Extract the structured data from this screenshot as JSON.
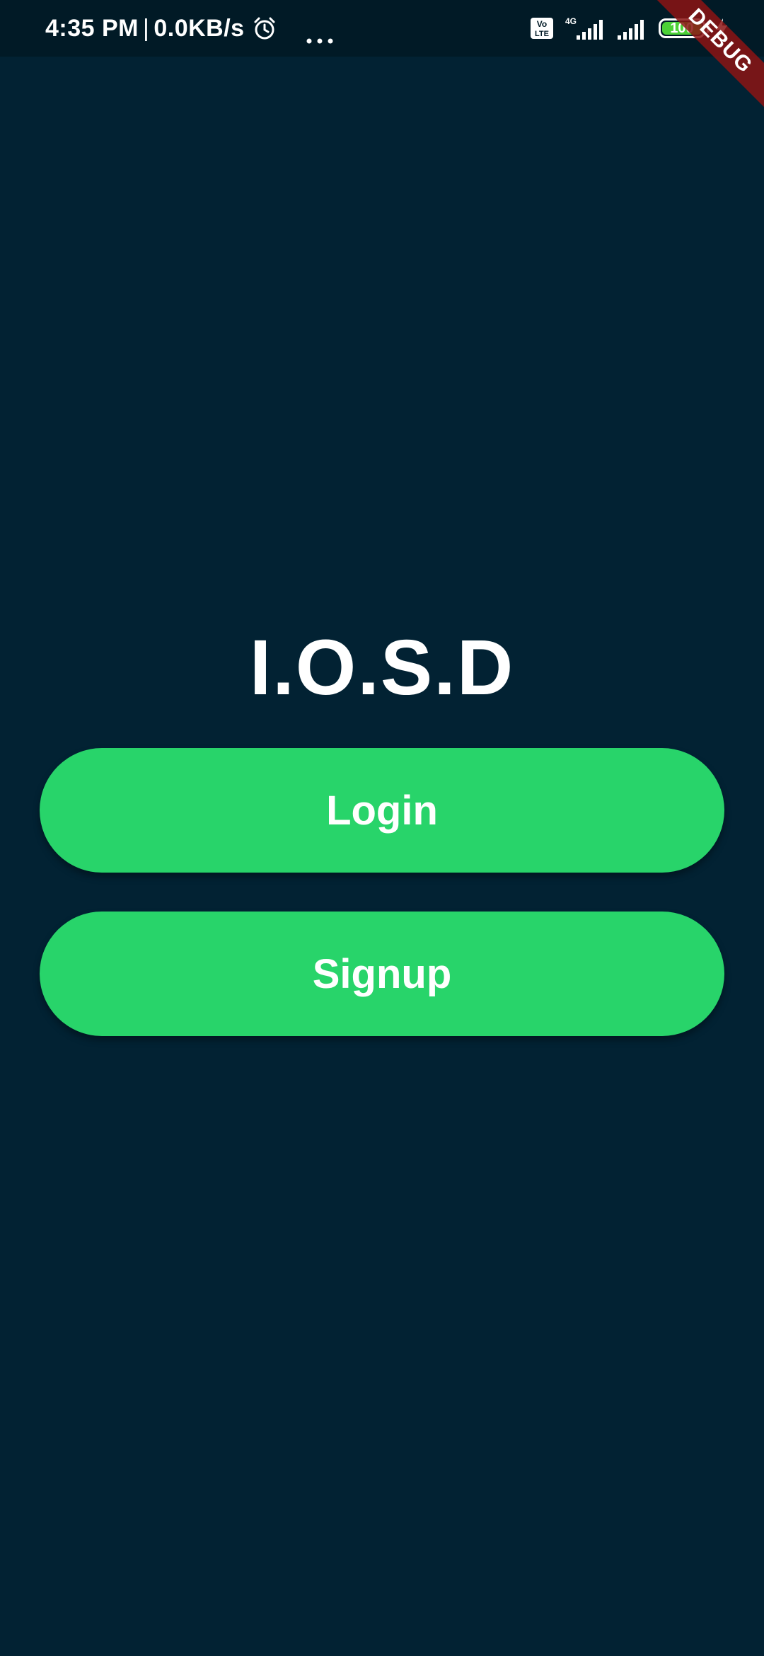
{
  "status_bar": {
    "time": "4:35 PM",
    "separator": "|",
    "net_speed": "0.0KB/s",
    "network_type": "4G",
    "battery_level": "100",
    "battery_fraction": 1.0,
    "icons": [
      "alarm-icon",
      "more-dots-icon",
      "volte-icon",
      "signal-icon",
      "signal-icon",
      "battery-icon",
      "charging-bolt-icon"
    ]
  },
  "debug_banner": {
    "label": "DEBUG"
  },
  "app": {
    "title": "I.O.S.D",
    "login_label": "Login",
    "signup_label": "Signup"
  },
  "colors": {
    "background": "#022233",
    "status_bar": "#011a26",
    "button": "#28d46a",
    "text": "#ffffff",
    "debug": "#8c1414",
    "battery": "#4cd137"
  }
}
